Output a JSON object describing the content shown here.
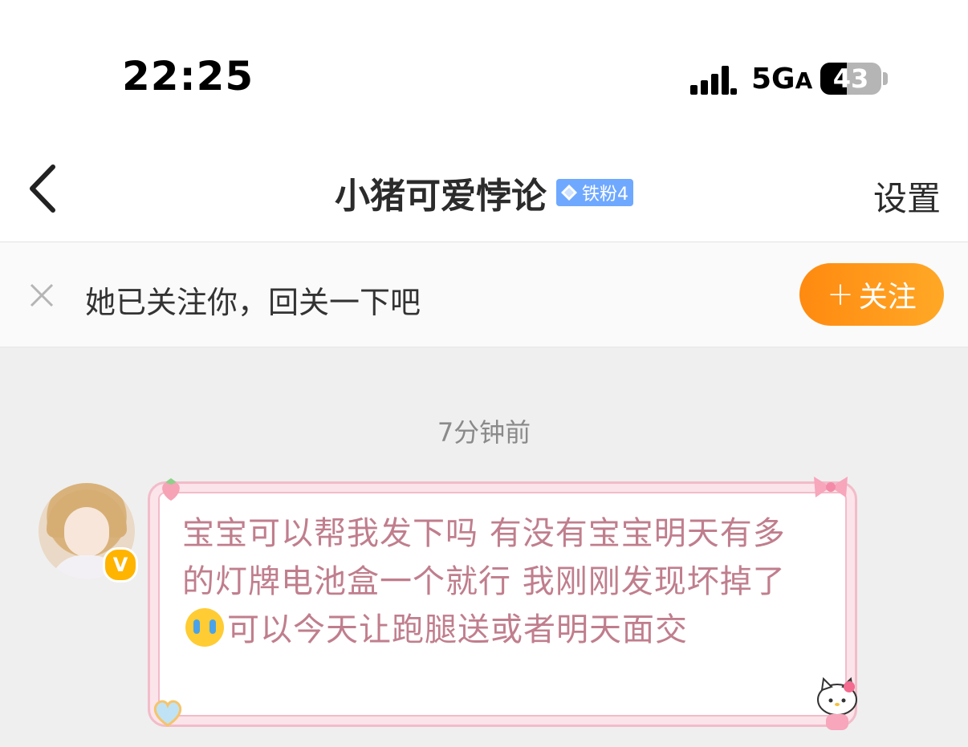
{
  "status_bar": {
    "time": "22:25",
    "network": "5G",
    "network_suffix": "A",
    "battery": "43",
    "battery_level_percent": 43
  },
  "nav": {
    "title": "小猪可爱悖论",
    "fan_badge": "铁粉4",
    "settings": "设置"
  },
  "follow_banner": {
    "text": "她已关注你，回关一下吧",
    "button": "关注"
  },
  "chat": {
    "timestamp": "7分钟前",
    "message_part1": "宝宝可以帮我发下吗 有没有宝宝明天有多的灯牌电池盒一个就行 我刚刚发现坏掉了",
    "message_part2": "可以今天让跑腿送或者明天面交",
    "verified_mark": "V"
  },
  "colors": {
    "follow_button": "#ff9419",
    "fan_badge": "#6fa8ff",
    "message_text": "#c07e8d",
    "bubble_border": "#f2bcc9"
  }
}
